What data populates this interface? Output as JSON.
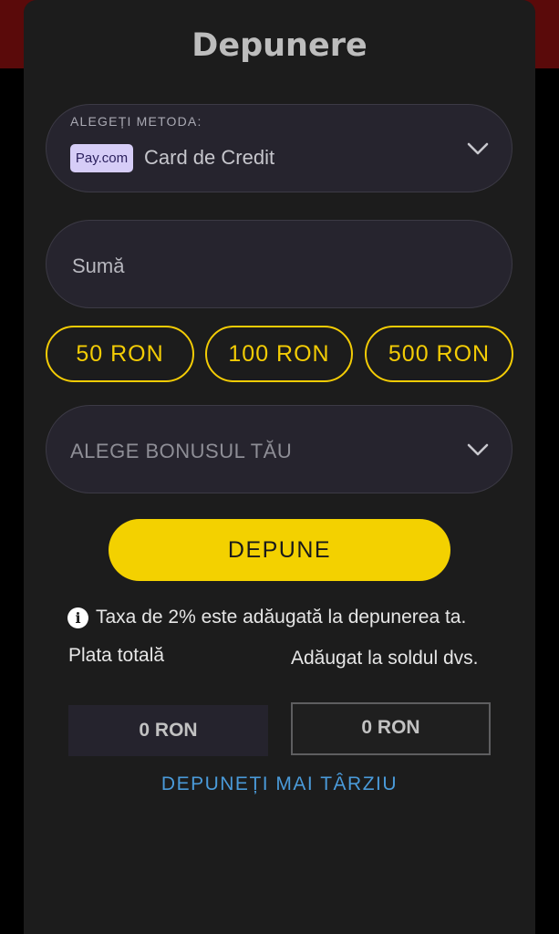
{
  "title": "Depunere",
  "method": {
    "label": "ALEGEȚI METODA:",
    "logo_text": "Pay.com",
    "value": "Card de Credit"
  },
  "amount": {
    "placeholder": "Sumă"
  },
  "quick_amounts": [
    "50 RON",
    "100 RON",
    "500 RON"
  ],
  "bonus": {
    "placeholder": "ALEGE BONUSUL TĂU"
  },
  "deposit_button": "DEPUNE",
  "info": {
    "icon_glyph": "i",
    "text": "Taxa de 2% este adăugată la depunerea ta."
  },
  "totals": {
    "total_label": "Plata totală",
    "total_value": "0 RON",
    "added_label": "Adăugat la soldul dvs.",
    "added_value": "0 RON"
  },
  "later_link": "DEPUNEȚI MAI TÂRZIU",
  "colors": {
    "accent": "#f3cc05",
    "button": "#f3d100",
    "link": "#4a9ad9",
    "panel": "#1c1c1c"
  }
}
